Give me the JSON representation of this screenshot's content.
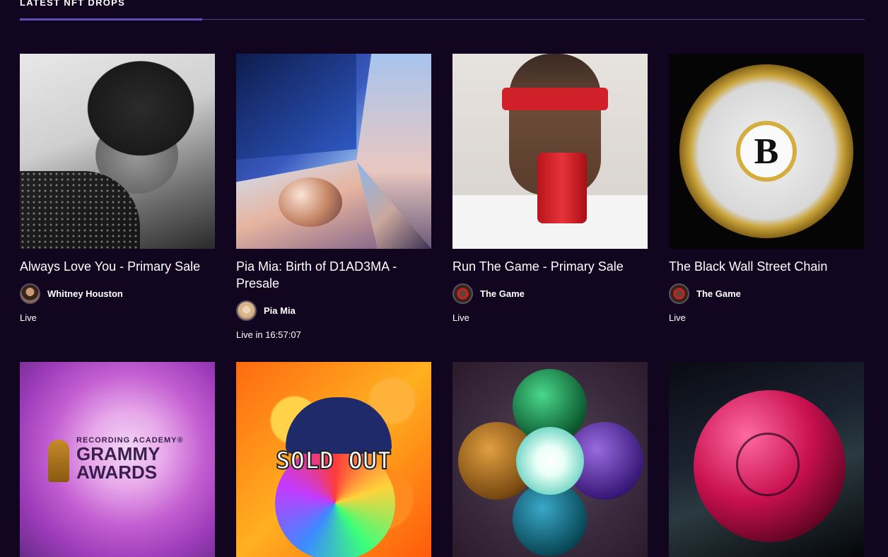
{
  "section": {
    "title": "LATEST NFT DROPS"
  },
  "colors": {
    "background": "#12051f",
    "accent_underline": "#5b4fb3",
    "text": "#ffffff"
  },
  "drops": [
    {
      "title": "Always Love You - Primary Sale",
      "creator": "Whitney Houston",
      "status": "Live",
      "artwork": "black-and-white portrait"
    },
    {
      "title": "Pia Mia: Birth of D1AD3MA - Presale",
      "creator": "Pia Mia",
      "status": "Live in 16:57:07",
      "artwork": "fantasy collage"
    },
    {
      "title": "Run The Game - Primary Sale",
      "creator": "The Game",
      "status": "Live",
      "artwork": "man with red bandana drinking from red cup"
    },
    {
      "title": "The Black Wall Street Chain",
      "creator": "The Game",
      "status": "Live",
      "artwork": "gold chain pendant",
      "pendant_text": "B"
    },
    {
      "title": "",
      "creator": "",
      "status": "",
      "artwork": "Grammy Awards logo",
      "logo_small": "RECORDING ACADEMY®",
      "logo_big_1": "GRAMMY",
      "logo_big_2": "AWARDS"
    },
    {
      "title": "",
      "creator": "",
      "status": "",
      "artwork": "cartoon character",
      "overlay_text": "SOLD OUT"
    },
    {
      "title": "",
      "creator": "",
      "status": "",
      "artwork": "five colored orbs"
    },
    {
      "title": "",
      "creator": "",
      "status": "",
      "artwork": "pink sphere"
    }
  ]
}
